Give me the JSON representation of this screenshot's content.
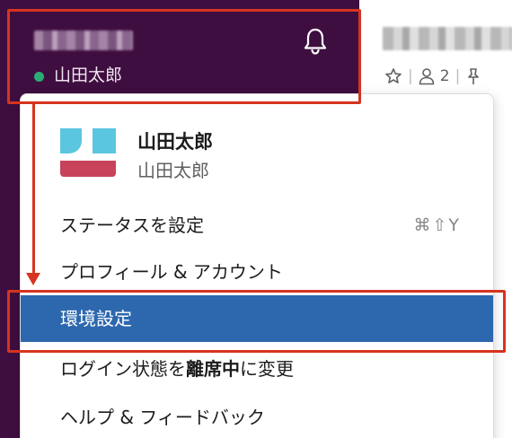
{
  "workspace": {
    "user_status_label": "山田太郎"
  },
  "channel": {
    "member_count": "2",
    "separator": "|"
  },
  "menu": {
    "profile": {
      "display_name": "山田太郎",
      "real_name": "山田太郎"
    },
    "items": [
      {
        "label": "ステータスを設定",
        "shortcut": "⌘⇧Y"
      },
      {
        "label": "プロフィール & アカウント"
      },
      {
        "label": "環境設定",
        "active": true
      },
      {
        "label_parts": [
          "ログイン状態を",
          "離席中",
          "に変更"
        ]
      },
      {
        "label": "ヘルプ & フィードバック"
      }
    ]
  },
  "colors": {
    "sidebar": "#3f0e40",
    "active_item": "#2d67ae",
    "annotation": "#d6341f",
    "status_online": "#2bac76"
  },
  "icons": [
    "bell-icon",
    "star-icon",
    "person-icon",
    "pin-icon"
  ]
}
